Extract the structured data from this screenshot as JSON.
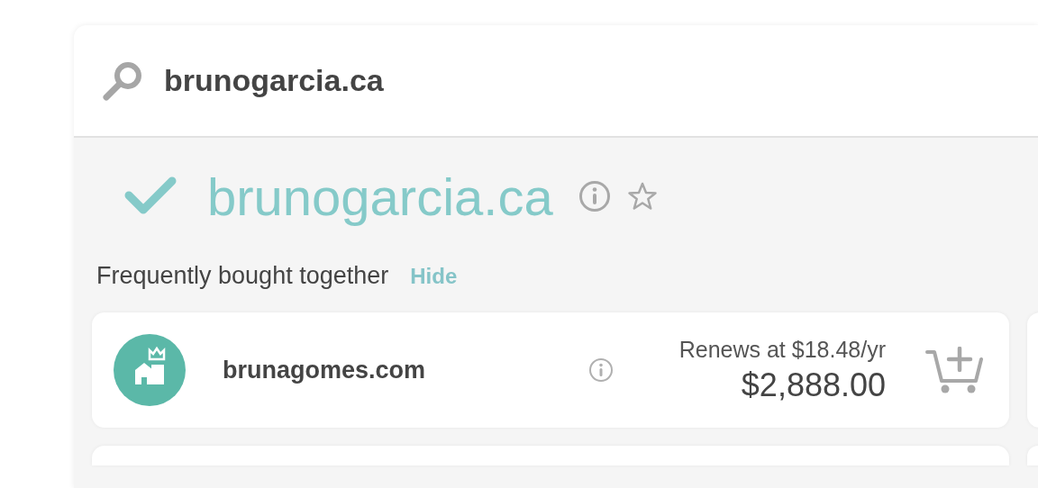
{
  "search": {
    "value": "brunogarcia.ca"
  },
  "result": {
    "domain": "brunogarcia.ca",
    "available": true,
    "favorited": false
  },
  "bundle": {
    "title": "Frequently bought together",
    "hide_link": "Hide",
    "items": [
      {
        "domain": "brunagomes.com",
        "renews": "Renews at $18.48/yr",
        "price": "$2,888.00"
      }
    ]
  }
}
